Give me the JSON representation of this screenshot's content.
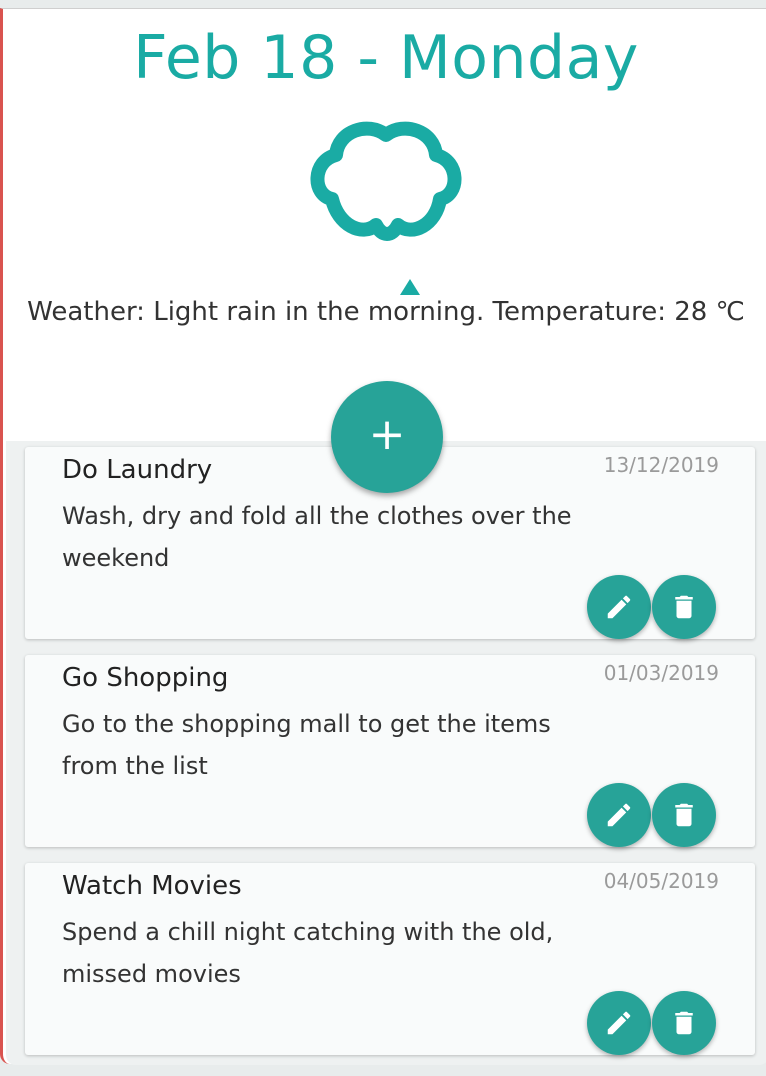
{
  "header": {
    "date": "Feb 18 - Monday",
    "weather_icon": "cloud-rain-icon",
    "weather_text": "Weather: Light rain in the morning. Temperature: 28 ℃"
  },
  "add_button": {
    "label": "+",
    "icon": "plus-icon"
  },
  "colors": {
    "accent": "#1aaba4",
    "button": "#27a398"
  },
  "tasks": [
    {
      "title": "Do Laundry",
      "date": "13/12/2019",
      "description": "Wash, dry and fold all the clothes over the weekend"
    },
    {
      "title": "Go Shopping",
      "date": "01/03/2019",
      "description": "Go to the shopping mall to get the items from the list"
    },
    {
      "title": "Watch Movies",
      "date": "04/05/2019",
      "description": "Spend a chill night catching with the old, missed movies"
    }
  ]
}
